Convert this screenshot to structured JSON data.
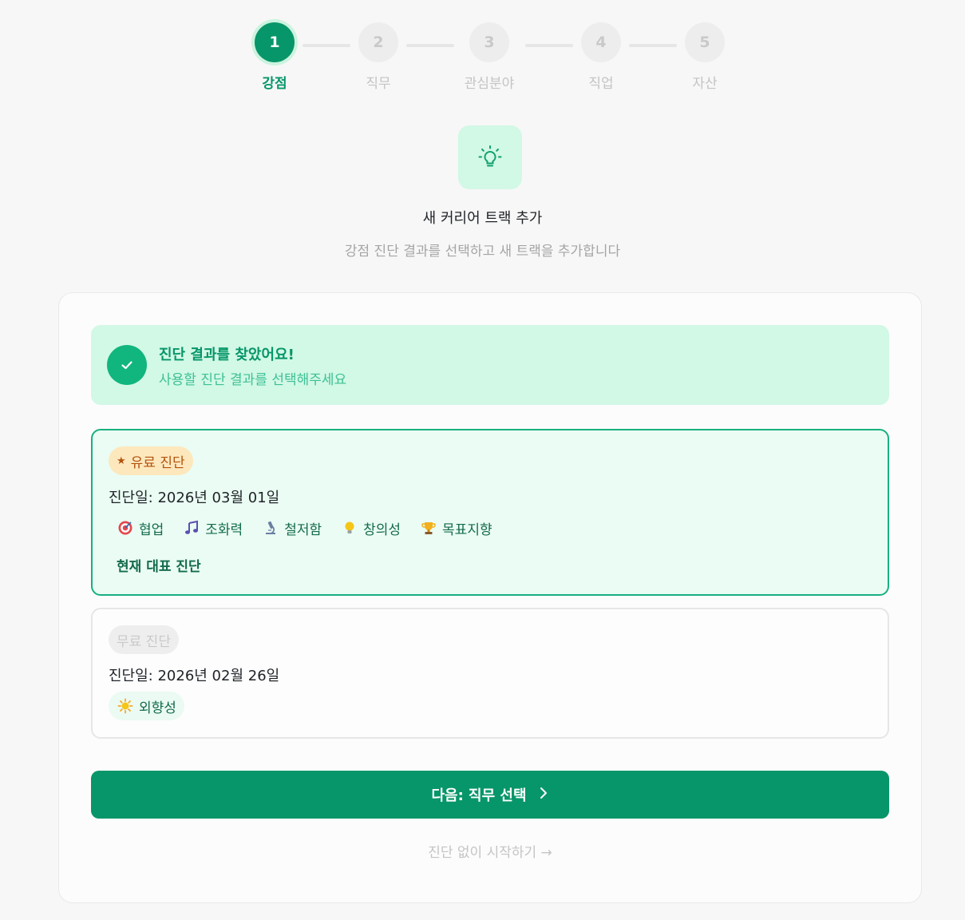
{
  "stepper": {
    "steps": [
      {
        "number": "1",
        "label": "강점",
        "state": "active"
      },
      {
        "number": "2",
        "label": "직무",
        "state": "upcoming"
      },
      {
        "number": "3",
        "label": "관심분야",
        "state": "upcoming"
      },
      {
        "number": "4",
        "label": "직업",
        "state": "upcoming"
      },
      {
        "number": "5",
        "label": "자산",
        "state": "upcoming"
      }
    ]
  },
  "hero": {
    "icon": "lightbulb-icon",
    "title": "새 커리어 트랙 추가",
    "subtitle": "강점 진단 결과를 선택하고 새 트랙을 추가합니다"
  },
  "found": {
    "icon": "check-icon",
    "title": "진단 결과를 찾았어요!",
    "subtitle": "사용할 진단 결과를 선택해주세요"
  },
  "diagnoses": [
    {
      "badge": "유료 진단",
      "badge_icon": "star-icon",
      "date": "진단일: 2026년 03월 01일",
      "selected": true,
      "strengths": [
        {
          "icon": "target-icon",
          "label": "협업"
        },
        {
          "icon": "music-note-icon",
          "label": "조화력"
        },
        {
          "icon": "microscope-icon",
          "label": "철저함"
        },
        {
          "icon": "lightbulb-icon",
          "label": "창의성"
        },
        {
          "icon": "trophy-icon",
          "label": "목표지향"
        }
      ],
      "representative_label": "현재 대표 진단"
    },
    {
      "badge": "무료 진단",
      "date": "진단일: 2026년 02월 26일",
      "selected": false,
      "strengths": [
        {
          "icon": "sun-icon",
          "label": "외향성"
        }
      ]
    }
  ],
  "actions": {
    "next_label": "다음: 직무 선택",
    "next_icon": "chevron-right-icon",
    "skip_label": "진단 없이 시작하기 →"
  },
  "colors": {
    "accent": "#079669",
    "accent_light": "#d2f8e6",
    "selected_border": "#17b080",
    "paid_badge_bg": "#fde8bd",
    "paid_badge_text": "#b4520f"
  }
}
